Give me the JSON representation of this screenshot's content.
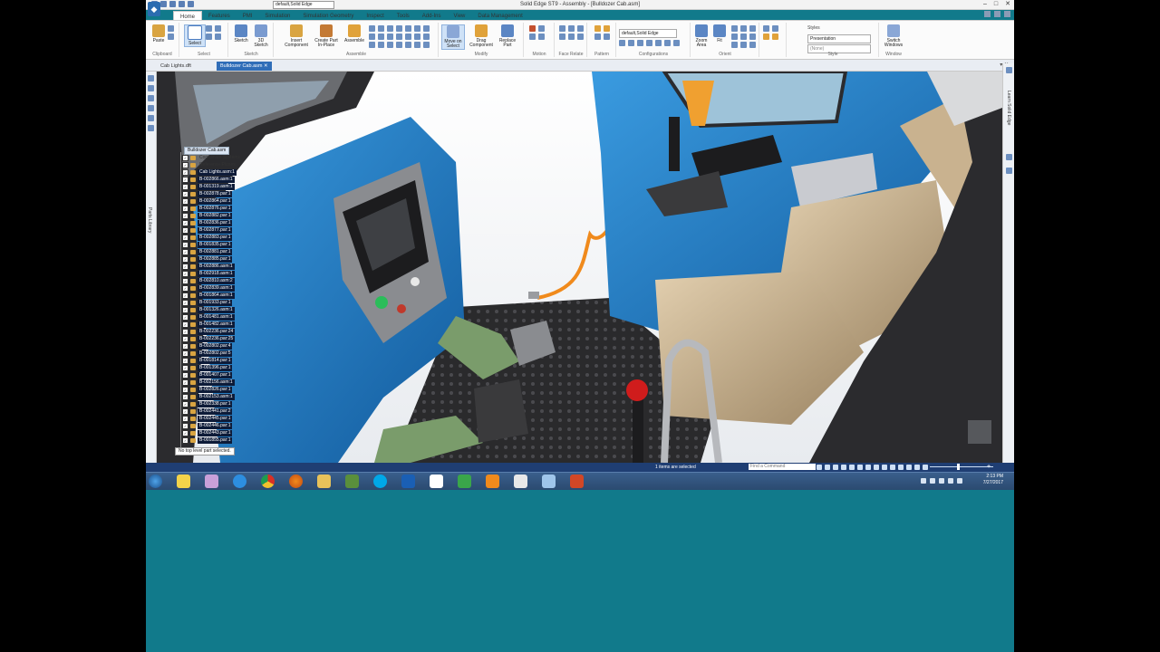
{
  "window": {
    "title": "Solid Edge ST9 - Assembly - [Bulldozer Cab.asm]",
    "config_combo": "default,Solid Edge",
    "controls": [
      "–",
      "□",
      "✕"
    ]
  },
  "ribbon": {
    "tabs": [
      "Home",
      "Features",
      "PMI",
      "Simulation",
      "Simulation Geometry",
      "Inspect",
      "Tools",
      "Add-Ins",
      "View",
      "Data Management"
    ],
    "active_tab": "Home",
    "groups": [
      {
        "label": "Clipboard",
        "buttons": [
          "Paste"
        ]
      },
      {
        "label": "Select",
        "buttons": [
          "Select"
        ]
      },
      {
        "label": "Sketch",
        "buttons": [
          "Sketch",
          "3D Sketch"
        ]
      },
      {
        "label": "Assemble",
        "buttons": [
          "Insert Component",
          "Create Part In-Place",
          "Assemble"
        ]
      },
      {
        "label": "Modify",
        "buttons": [
          "Move on Select",
          "Drag Component",
          "Replace Part"
        ]
      },
      {
        "label": "Motion",
        "buttons": []
      },
      {
        "label": "Face Relate",
        "buttons": []
      },
      {
        "label": "Pattern",
        "buttons": []
      },
      {
        "label": "Configurations",
        "buttons": []
      },
      {
        "label": "Orient",
        "buttons": [
          "Zoom Area",
          "Fit"
        ]
      },
      {
        "label": "Style",
        "buttons": []
      },
      {
        "label": "Window",
        "buttons": [
          "Switch Windows"
        ]
      }
    ],
    "config_value": "default,Solid Edge",
    "styles_label": "Styles",
    "style_value": "Presentation",
    "style_none": "(None)"
  },
  "doc_tabs": [
    {
      "label": "Cab Lights.dft",
      "active": false
    },
    {
      "label": "Bulldozer Cab.asm",
      "active": true
    }
  ],
  "pathfinder": {
    "root": "Bulldozer Cab.asm",
    "items": [
      {
        "label": "Coordinate Systems",
        "dim": true
      },
      {
        "label": "Reference Planes",
        "dim": true
      },
      {
        "label": "Cab Lights.asm:1",
        "dim": false
      },
      {
        "label": "B-002866.asm:1",
        "dim": false
      },
      {
        "label": "B-001319.asm:1",
        "dim": false
      },
      {
        "label": "B-002878.par:1",
        "dim": false
      },
      {
        "label": "B-002864.par:1",
        "dim": false
      },
      {
        "label": "B-002876.par:1",
        "dim": false
      },
      {
        "label": "B-002882.par:1",
        "dim": false
      },
      {
        "label": "B-002836.par:1",
        "dim": false
      },
      {
        "label": "B-002877.par:1",
        "dim": false
      },
      {
        "label": "B-002883.par:1",
        "dim": false
      },
      {
        "label": "B-001835.par:1",
        "dim": false
      },
      {
        "label": "B-002881.par:1",
        "dim": false
      },
      {
        "label": "B-002885.par:1",
        "dim": false
      },
      {
        "label": "B-002886.asm:1",
        "dim": false
      },
      {
        "label": "B-002918.asm:1",
        "dim": false
      },
      {
        "label": "B-002810.asm:2",
        "dim": false
      },
      {
        "label": "B-002839.asm:1",
        "dim": false
      },
      {
        "label": "B-001864.asm:1",
        "dim": false
      },
      {
        "label": "B-001933.par:1",
        "dim": false
      },
      {
        "label": "B-001326.asm:1",
        "dim": false
      },
      {
        "label": "B-001481.asm:1",
        "dim": false
      },
      {
        "label": "B-001482.asm:1",
        "dim": false
      },
      {
        "label": "B-002236.par:24",
        "dim": false
      },
      {
        "label": "B-002236.par:25",
        "dim": false
      },
      {
        "label": "B-002802.par:4",
        "dim": false
      },
      {
        "label": "B-002802.par:5",
        "dim": false
      },
      {
        "label": "B-001814.par:1",
        "dim": false
      },
      {
        "label": "B-001396.par:1",
        "dim": false
      },
      {
        "label": "B-001407.par:1",
        "dim": false
      },
      {
        "label": "B-002156.asm:1",
        "dim": false
      },
      {
        "label": "B-002826.par:1",
        "dim": false
      },
      {
        "label": "B-002153.asm:1",
        "dim": false
      },
      {
        "label": "B-002338.par:1",
        "dim": false
      },
      {
        "label": "B-002441.par:2",
        "dim": false
      },
      {
        "label": "B-002445.par:1",
        "dim": false
      },
      {
        "label": "B-002446.par:1",
        "dim": false
      },
      {
        "label": "B-002443.par:1",
        "dim": false
      },
      {
        "label": "B-001855.par:1",
        "dim": false
      }
    ],
    "status": "No top level part selected."
  },
  "right_panel": {
    "label": "Learn Solid Edge"
  },
  "left_panel": {
    "label": "Parts Library"
  },
  "statusbar": {
    "message": "1 items are selected",
    "find_placeholder": "Find a Command"
  },
  "taskbar": {
    "time": "2:13 PM",
    "date": "7/27/2017",
    "apps": [
      "start-orb",
      "sticky-icon",
      "paint-icon",
      "ie-icon",
      "chrome-icon",
      "firefox-icon",
      "explorer-icon",
      "python-icon",
      "skype-icon",
      "outlook-icon",
      "camtasia-icon",
      "camtasia-rec-icon",
      "vlc-icon",
      "pn-icon",
      "solidedge-icon",
      "powerpoint-icon"
    ]
  },
  "colors": {
    "accent": "#2f6db8",
    "desktop": "#117a8b",
    "cab_blue": "#1b78c4",
    "seat_tan": "#c9b28f"
  }
}
